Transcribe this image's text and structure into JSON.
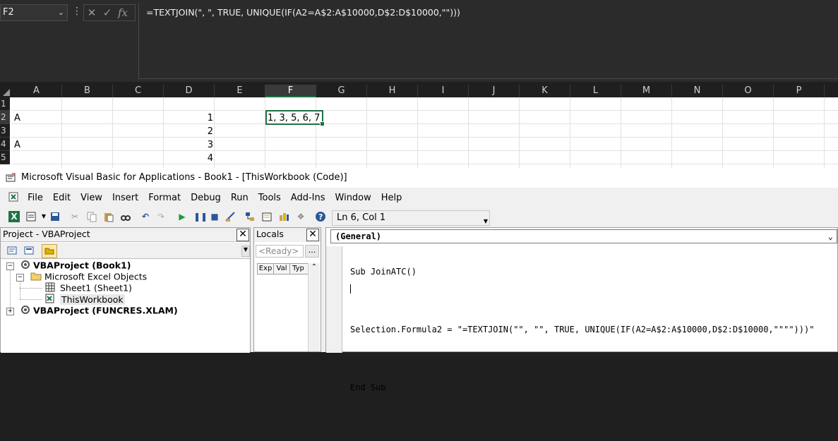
{
  "formula_bar": {
    "name_box": "F2",
    "formula": "=TEXTJOIN(\", \", TRUE, UNIQUE(IF(A2=A$2:A$10000,D$2:D$10000,\"\")))",
    "icons": [
      "cancel-icon",
      "enter-icon",
      "fx-icon"
    ]
  },
  "grid": {
    "columns": [
      "A",
      "B",
      "C",
      "D",
      "E",
      "F",
      "G",
      "H",
      "I",
      "J",
      "K",
      "L",
      "M",
      "N",
      "O",
      "P"
    ],
    "selected_column": "F",
    "rows": [
      "1",
      "2",
      "3",
      "4",
      "5"
    ],
    "cells": {
      "A2": "A",
      "D2": "1",
      "F2": "1, 3, 5, 6, 7",
      "D3": "2",
      "A4": "A",
      "D4": "3",
      "D5": "4"
    }
  },
  "vba": {
    "title": "Microsoft Visual Basic for Applications - Book1 - [ThisWorkbook (Code)]",
    "menu": [
      "File",
      "Edit",
      "View",
      "Insert",
      "Format",
      "Debug",
      "Run",
      "Tools",
      "Add-Ins",
      "Window",
      "Help"
    ],
    "cursor_position": "Ln 6, Col 1",
    "project_pane": {
      "title": "Project - VBAProject",
      "tree": [
        {
          "label": "VBAProject (Book1)",
          "level": 0,
          "bold": true,
          "expanded": true
        },
        {
          "label": "Microsoft Excel Objects",
          "level": 1,
          "bold": false,
          "expanded": true
        },
        {
          "label": "Sheet1 (Sheet1)",
          "level": 2,
          "bold": false
        },
        {
          "label": "ThisWorkbook",
          "level": 2,
          "bold": false,
          "selected": true
        },
        {
          "label": "VBAProject (FUNCRES.XLAM)",
          "level": 0,
          "bold": true,
          "expanded": false
        }
      ]
    },
    "locals_pane": {
      "title": "Locals",
      "status": "<Ready>",
      "dots": "...",
      "columns": [
        "Exp",
        "Val",
        "Typ"
      ]
    },
    "code_pane": {
      "object_combo": "(General)",
      "lines": [
        "Sub JoinATC()",
        "",
        "Selection.Formula2 = \"=TEXTJOIN(\"\", \"\", TRUE, UNIQUE(IF(A2=A$2:A$10000,D$2:D$10000,\"\"\"\")))\"",
        "",
        "End Sub",
        ""
      ]
    }
  },
  "colors": {
    "excel_green": "#1e7145",
    "dark_bg": "#1f1f1f",
    "formula_bar_bg": "#2b2b2b"
  }
}
